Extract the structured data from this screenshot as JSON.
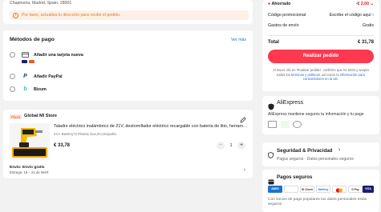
{
  "address": {
    "line": "Chapineria, Madrid, Spain, 28001",
    "alert": "Por favor, actualiza tu dirección para recibir el pedido."
  },
  "payment": {
    "title": "Métodos de pago",
    "see_more": "Ver más",
    "options": [
      {
        "label": "Añadir una tarjeta nueva",
        "icon": "credit-card-icon"
      },
      {
        "label": "Añadir PayPal",
        "icon": "paypal-icon"
      },
      {
        "label": "Bizum",
        "icon": "bizum-icon"
      }
    ]
  },
  "store": {
    "tag": "Plaza",
    "name": "Global MI Store",
    "product": {
      "title": "Taladro eléctrico inalámbrico de 21V, destornillador eléctrico recargable con batería de litio, herramienta",
      "variant": "21V Battery*2 Plastic box,EU,España",
      "price": "€ 33,78",
      "quantity": "1",
      "minus": "−",
      "plus": "+"
    },
    "shipping_line1": "Envío: Envío gratis",
    "shipping_line2": "Entrega: 19 – 21 de MAR"
  },
  "summary": {
    "discount_label": "Ahorrado",
    "discount_value": "-€ 2,00",
    "promo_label": "Código promocional",
    "promo_value": "Escribe el código aquí",
    "shipping_label": "Gastos de envío",
    "shipping_value": "Gratis",
    "total_label": "Total",
    "total_value": "€ 31,78",
    "order_button": "Realizar pedido",
    "terms_prefix": "Al hacer clic en 'Realizar pedido', confirmo que he leído y acepto todos los ",
    "terms_link": "términos y políticas",
    "terms_mid": ", así como la ",
    "terms_link2": "información para consumidores en la UE",
    "terms_end": "."
  },
  "aliexpress": {
    "brand": "AliExpress",
    "text": "AliExpress mantiene seguros tu información y tu pago"
  },
  "security": {
    "title": "Seguridad & Privacidad",
    "subtitle": "Pagos seguros · Datos personales seguros"
  },
  "pagos": {
    "title": "Pagos seguros",
    "text": "Con socios de pago populares tus datos personales están seguros.",
    "badges": [
      "AMEX",
      "",
      "ID Check",
      "SafeKey",
      "",
      "G Pay",
      "VISA"
    ]
  },
  "colors": {
    "accent": "#fd384f",
    "link": "#1e6fd9",
    "warning": "#e07a2a",
    "discount": "#e81717"
  }
}
